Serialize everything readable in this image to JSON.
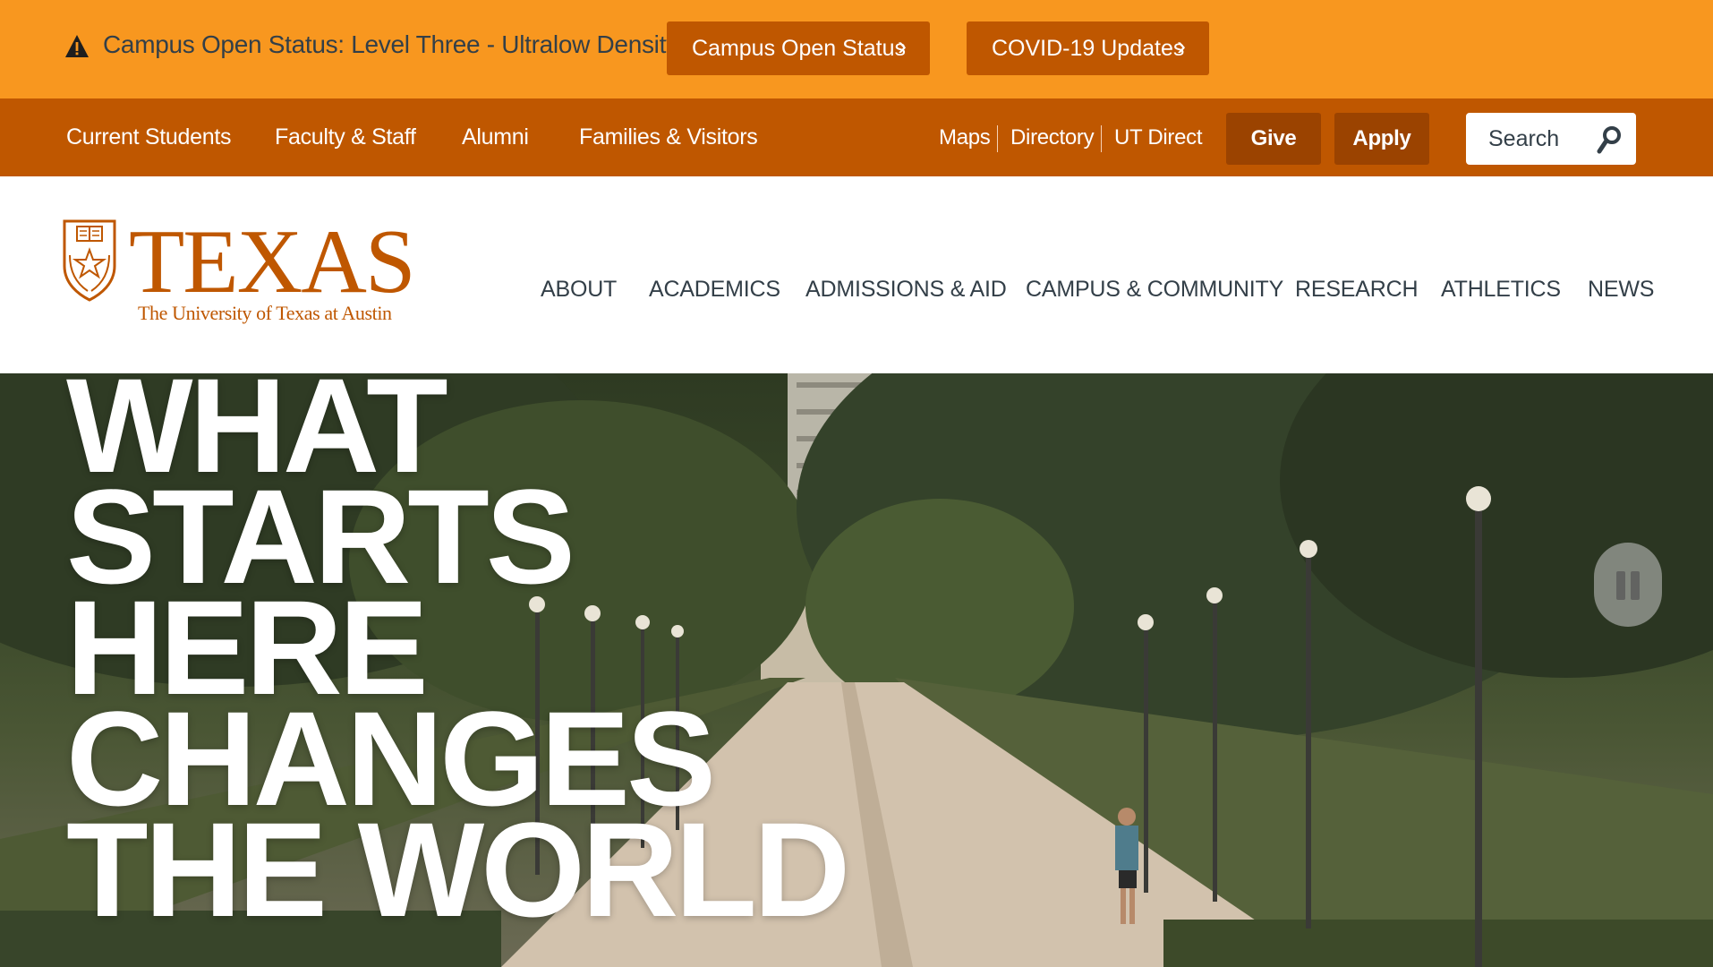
{
  "alert": {
    "icon": "warning-icon",
    "text": "Campus Open Status: Level Three - Ultralow Density",
    "buttons": [
      {
        "label": "Campus Open Status",
        "icon": "chevron-right-icon"
      },
      {
        "label": "COVID-19 Updates",
        "icon": "chevron-right-icon"
      }
    ]
  },
  "utility_nav": {
    "audience_links": [
      "Current Students",
      "Faculty & Staff",
      "Alumni",
      "Families & Visitors"
    ],
    "quick_links": [
      "Maps",
      "Directory",
      "UT Direct"
    ],
    "give_label": "Give",
    "apply_label": "Apply",
    "search": {
      "placeholder": "Search",
      "value": "",
      "icon": "search-icon"
    }
  },
  "header": {
    "logo": {
      "wordmark": "TEXAS",
      "subtitle": "The University of Texas at Austin",
      "emblem": "shield-icon"
    },
    "main_nav": [
      "ABOUT",
      "ACADEMICS",
      "ADMISSIONS & AID",
      "CAMPUS & COMMUNITY",
      "RESEARCH",
      "ATHLETICS",
      "NEWS"
    ]
  },
  "hero": {
    "headline_lines": [
      "WHAT",
      "STARTS",
      "HERE",
      "CHANGES",
      "THE WORLD"
    ],
    "pause_icon": "pause-icon"
  },
  "colors": {
    "alert_orange": "#f8971f",
    "burnt_orange": "#bf5700",
    "cta_dark": "#9b4300",
    "text_charcoal": "#333f48"
  }
}
